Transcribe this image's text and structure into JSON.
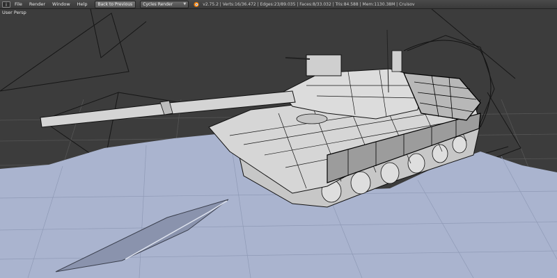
{
  "header": {
    "menus": [
      "File",
      "Render",
      "Window",
      "Help"
    ],
    "back_button": "Back to Previous",
    "render_engine": "Cycles Render",
    "stats": "v2.75.2 | Verts:16/36.472 | Edges:23/89.035 | Faces:8/33.032 | Tris:84.588 | Mem:1130.38M | Cruisov"
  },
  "viewport": {
    "label": "User Persp"
  },
  "colors": {
    "header_bg": "#444444",
    "viewport_bg": "#3c3c3c",
    "grid_line": "#545454",
    "snow": "#aab4cf",
    "tank_body": "#d6d6d6",
    "wireframe": "#111111"
  },
  "icons": {
    "editor_type": "info-editor-icon",
    "engine_logo": "blender-logo-icon"
  }
}
